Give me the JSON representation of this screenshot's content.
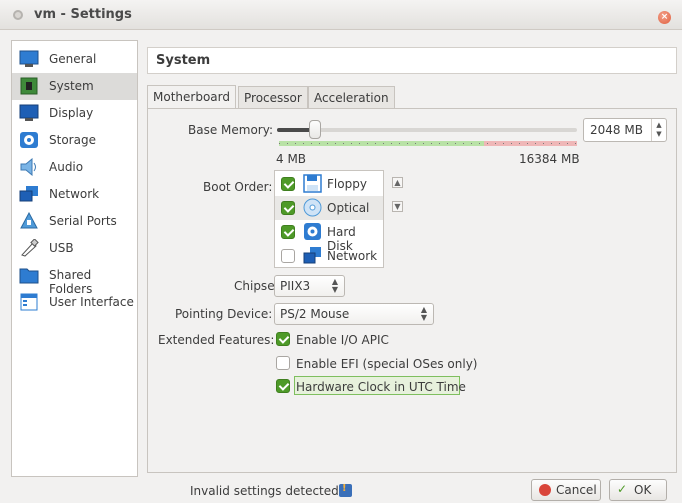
{
  "window": {
    "title": "vm - Settings"
  },
  "sidebar": {
    "items": [
      {
        "label": "General",
        "icon": "general-icon"
      },
      {
        "label": "System",
        "icon": "system-icon",
        "selected": true
      },
      {
        "label": "Display",
        "icon": "display-icon"
      },
      {
        "label": "Storage",
        "icon": "storage-icon"
      },
      {
        "label": "Audio",
        "icon": "audio-icon"
      },
      {
        "label": "Network",
        "icon": "network-icon"
      },
      {
        "label": "Serial Ports",
        "icon": "serial-ports-icon"
      },
      {
        "label": "USB",
        "icon": "usb-icon"
      },
      {
        "label": "Shared Folders",
        "icon": "shared-folders-icon"
      },
      {
        "label": "User Interface",
        "icon": "user-interface-icon"
      }
    ]
  },
  "header": {
    "title": "System"
  },
  "tabs": [
    {
      "label": "Motherboard",
      "active": true
    },
    {
      "label": "Processor"
    },
    {
      "label": "Acceleration"
    }
  ],
  "motherboard": {
    "base_memory": {
      "label": "Base Memory:",
      "value": "2048 MB",
      "min_label": "4 MB",
      "max_label": "16384 MB",
      "fraction": 0.125
    },
    "boot_order": {
      "label": "Boot Order:",
      "items": [
        {
          "label": "Floppy",
          "checked": true
        },
        {
          "label": "Optical",
          "checked": true
        },
        {
          "label": "Hard Disk",
          "checked": true
        },
        {
          "label": "Network",
          "checked": false
        }
      ]
    },
    "chipset": {
      "label": "Chipset:",
      "value": "PIIX3"
    },
    "pointing_device": {
      "label": "Pointing Device:",
      "value": "PS/2 Mouse"
    },
    "extended_features": {
      "label": "Extended Features:",
      "options": [
        {
          "label": "Enable I/O APIC",
          "checked": true
        },
        {
          "label": "Enable EFI (special OSes only)",
          "checked": false
        },
        {
          "label": "Hardware Clock in UTC Time",
          "checked": true
        }
      ]
    }
  },
  "status": {
    "text": "Invalid settings detected"
  },
  "buttons": {
    "cancel": "Cancel",
    "ok": "OK"
  },
  "colors": {
    "accent_green": "#4e9a28",
    "close_orange": "#e0603f",
    "selection": "#dcdbd9"
  }
}
